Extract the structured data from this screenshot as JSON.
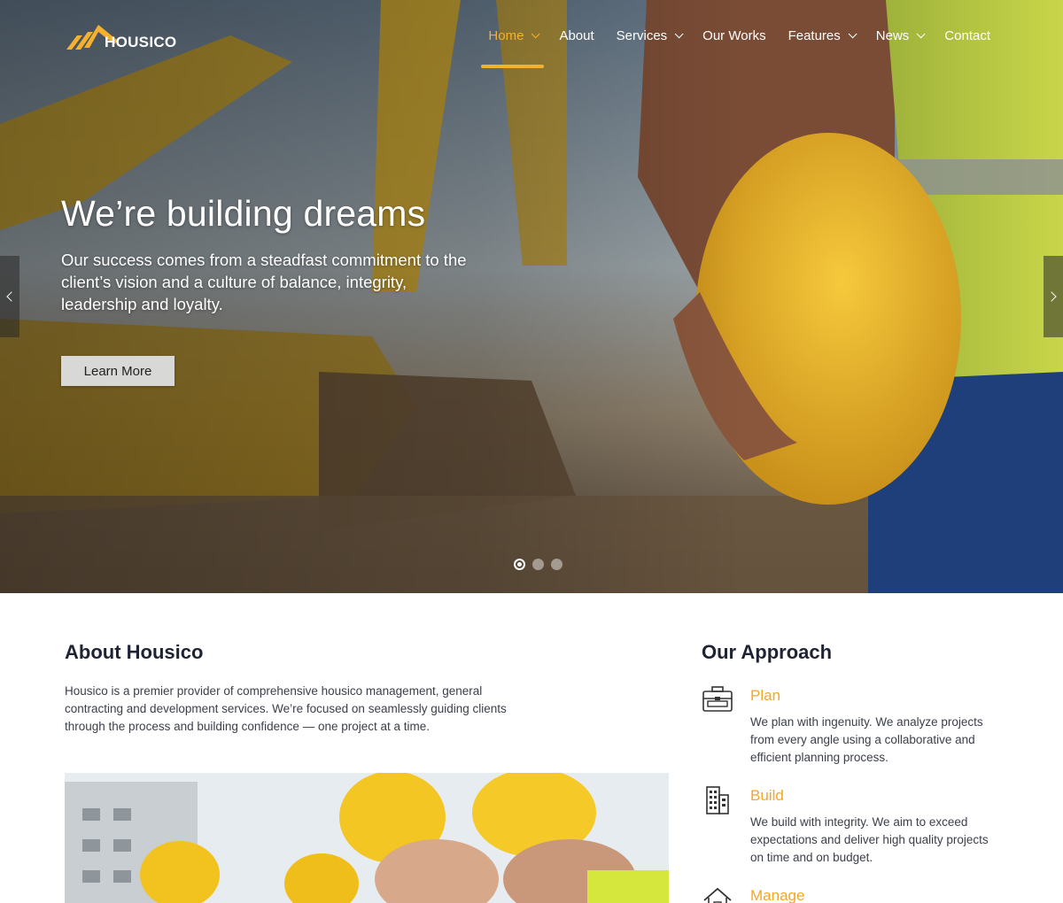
{
  "brand": {
    "name": "HOUSICO",
    "accent": "#f5b12e"
  },
  "nav": {
    "items": [
      {
        "label": "Home",
        "active": true,
        "dropdown": true
      },
      {
        "label": "About",
        "active": false,
        "dropdown": false
      },
      {
        "label": "Services",
        "active": false,
        "dropdown": true
      },
      {
        "label": "Our Works",
        "active": false,
        "dropdown": false
      },
      {
        "label": "Features",
        "active": false,
        "dropdown": true
      },
      {
        "label": "News",
        "active": false,
        "dropdown": true
      },
      {
        "label": "Contact",
        "active": false,
        "dropdown": false
      }
    ]
  },
  "hero": {
    "title": "We’re building dreams",
    "subtitle": "Our success comes from a steadfast commitment to the client’s vision and a culture of balance, integrity, leadership and loyalty.",
    "button_label": "Learn More",
    "slides": 3,
    "active_slide": 1,
    "prev_icon": "chevron-left-icon",
    "next_icon": "chevron-right-icon"
  },
  "about": {
    "title": "About Housico",
    "text": "Housico is a premier provider of comprehensive housico management, general contracting and development services. We’re focused on seamlessly guiding clients through the process and building confidence — one project at a time."
  },
  "approach": {
    "title": "Our Approach",
    "items": [
      {
        "name": "Plan",
        "icon": "toolbox-icon",
        "desc": "We plan with ingenuity. We analyze projects from every angle using a collaborative and efficient planning process."
      },
      {
        "name": "Build",
        "icon": "building-icon",
        "desc": "We build with integrity. We aim to exceed expectations and deliver high quality projects on time and on budget."
      },
      {
        "name": "Manage",
        "icon": "house-icon",
        "desc": ""
      }
    ]
  }
}
